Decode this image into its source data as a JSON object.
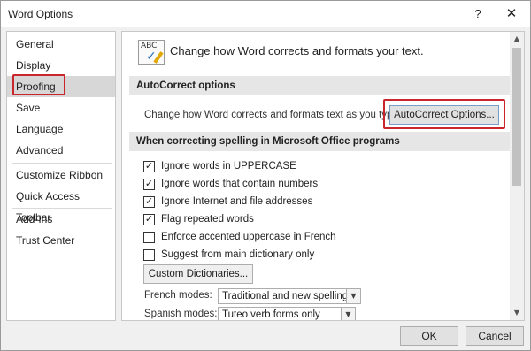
{
  "window": {
    "title": "Word Options",
    "help_label": "?",
    "close_label": "✕"
  },
  "nav": {
    "items": [
      {
        "label": "General"
      },
      {
        "label": "Display"
      },
      {
        "label": "Proofing",
        "selected": true
      },
      {
        "label": "Save"
      },
      {
        "label": "Language"
      },
      {
        "label": "Advanced"
      },
      {
        "label": "Customize Ribbon"
      },
      {
        "label": "Quick Access Toolbar"
      },
      {
        "label": "Add-Ins"
      },
      {
        "label": "Trust Center"
      }
    ]
  },
  "main": {
    "header_icon": "abc-spellcheck-icon",
    "header_icon_text": "ABC",
    "header_text": "Change how Word corrects and formats your text.",
    "autocorrect": {
      "section_title": "AutoCorrect options",
      "description": "Change how Word corrects and formats text as you type:",
      "button_label": "AutoCorrect Options..."
    },
    "spelling": {
      "section_title": "When correcting spelling in Microsoft Office programs",
      "options": [
        {
          "label": "Ignore words in UPPERCASE",
          "checked": true
        },
        {
          "label": "Ignore words that contain numbers",
          "checked": true
        },
        {
          "label": "Ignore Internet and file addresses",
          "checked": true
        },
        {
          "label": "Flag repeated words",
          "checked": true
        },
        {
          "label": "Enforce accented uppercase in French",
          "checked": false
        },
        {
          "label": "Suggest from main dictionary only",
          "checked": false
        }
      ],
      "custom_dictionaries_label": "Custom Dictionaries...",
      "french_modes_label": "French modes:",
      "french_modes_value": "Traditional and new spellings",
      "spanish_modes_label": "Spanish modes:",
      "spanish_modes_value": "Tuteo verb forms only"
    }
  },
  "footer": {
    "ok_label": "OK",
    "cancel_label": "Cancel"
  },
  "colors": {
    "highlight_border": "#c9252c",
    "selected_nav": "#d7d7d7",
    "section_header": "#e6e6e6"
  }
}
